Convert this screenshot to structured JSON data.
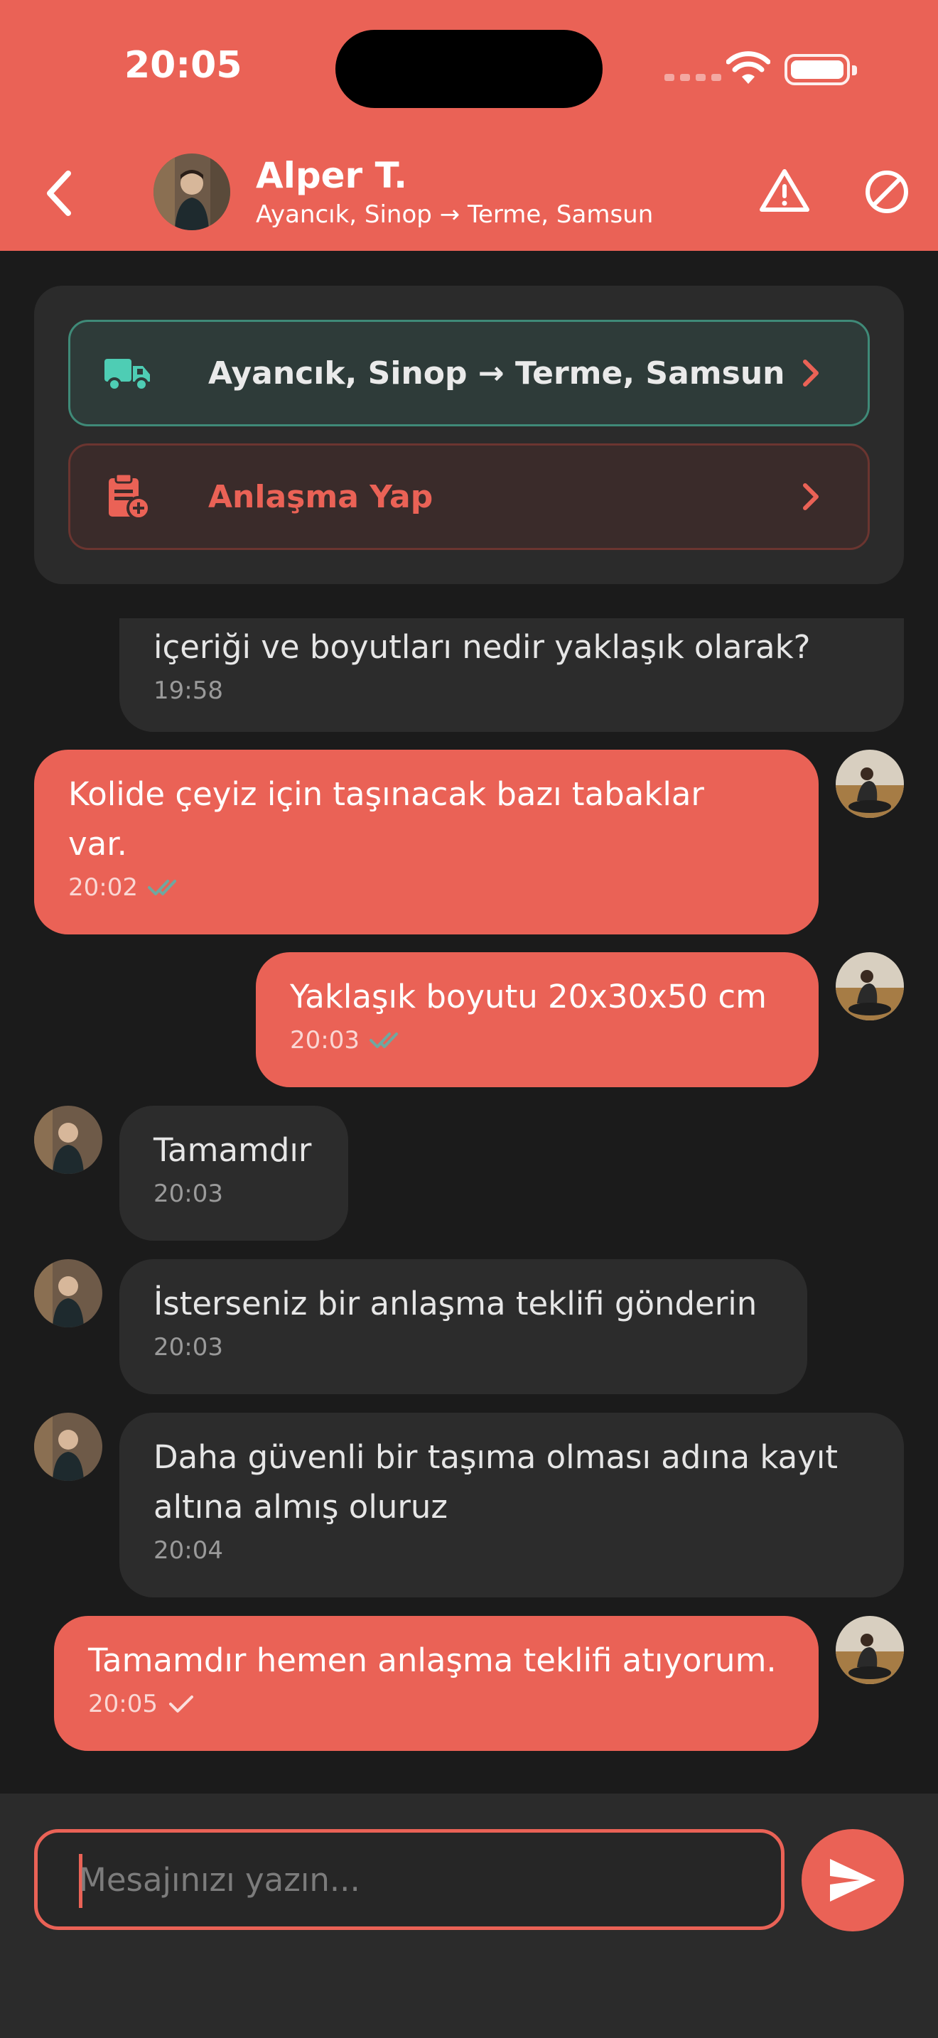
{
  "status_bar": {
    "time": "20:05"
  },
  "header": {
    "name": "Alper T.",
    "route": "Ayancık, Sinop → Terme, Samsun",
    "icons": [
      "chevron-left-icon",
      "warning-icon",
      "block-icon"
    ]
  },
  "actions": {
    "route_label": "Ayancık, Sinop → Terme, Samsun",
    "deal_label": "Anlaşma Yap",
    "route_color": "#4ecdb4",
    "deal_color": "#ea6256"
  },
  "messages": [
    {
      "direction": "in",
      "text": "içeriği  ve boyutları nedir yaklaşık olarak?",
      "time": "19:58"
    },
    {
      "direction": "out",
      "text": "Kolide çeyiz için taşınacak bazı tabaklar var.",
      "time": "20:02",
      "status": "read"
    },
    {
      "direction": "out",
      "text": "Yaklaşık boyutu 20x30x50 cm",
      "time": "20:03",
      "status": "read"
    },
    {
      "direction": "in",
      "text": "Tamamdır",
      "time": "20:03"
    },
    {
      "direction": "in",
      "text": "İsterseniz bir anlaşma teklifi gönderin",
      "time": "20:03"
    },
    {
      "direction": "in",
      "text": "Daha güvenli bir taşıma olması adına kayıt altına almış oluruz",
      "time": "20:04"
    },
    {
      "direction": "out",
      "text": "Tamamdır hemen anlaşma teklifi atıyorum.",
      "time": "20:05",
      "status": "sent"
    }
  ],
  "composer": {
    "placeholder": "Mesajınızı yazın..."
  },
  "colors": {
    "accent": "#ea6256",
    "background": "#1b1b1b",
    "incoming_bubble": "#2c2c2c",
    "read_tick": "#6fa8a0"
  }
}
